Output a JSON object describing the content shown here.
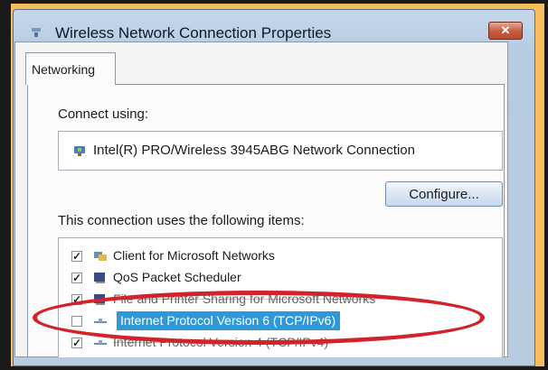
{
  "window": {
    "title": "Wireless Network Connection Properties",
    "close_label": "✕"
  },
  "tabs": [
    {
      "label": "Networking",
      "selected": true
    }
  ],
  "connect_using": {
    "label": "Connect using:",
    "adapter_name": "Intel(R) PRO/Wireless 3945ABG Network Connection"
  },
  "configure_button": {
    "label": "Configure..."
  },
  "items_section": {
    "label": "This connection uses the following items:",
    "items": [
      {
        "label": "Client for Microsoft Networks",
        "checked": true,
        "icon": "network-client-icon"
      },
      {
        "label": "QoS Packet Scheduler",
        "checked": true,
        "icon": "scheduler-icon"
      },
      {
        "label": "File and Printer Sharing for Microsoft Networks",
        "checked": true,
        "icon": "file-sharing-icon"
      },
      {
        "label": "Internet Protocol Version 6 (TCP/IPv6)",
        "checked": false,
        "selected": true,
        "icon": "protocol-icon"
      },
      {
        "label": "Internet Protocol Version 4 (TCP/IPv4)",
        "checked": true,
        "icon": "protocol-icon"
      }
    ]
  },
  "annotation": {
    "color": "#d2222a"
  },
  "colors": {
    "background": "#f6bd5c",
    "selection": "#2f98d8"
  }
}
